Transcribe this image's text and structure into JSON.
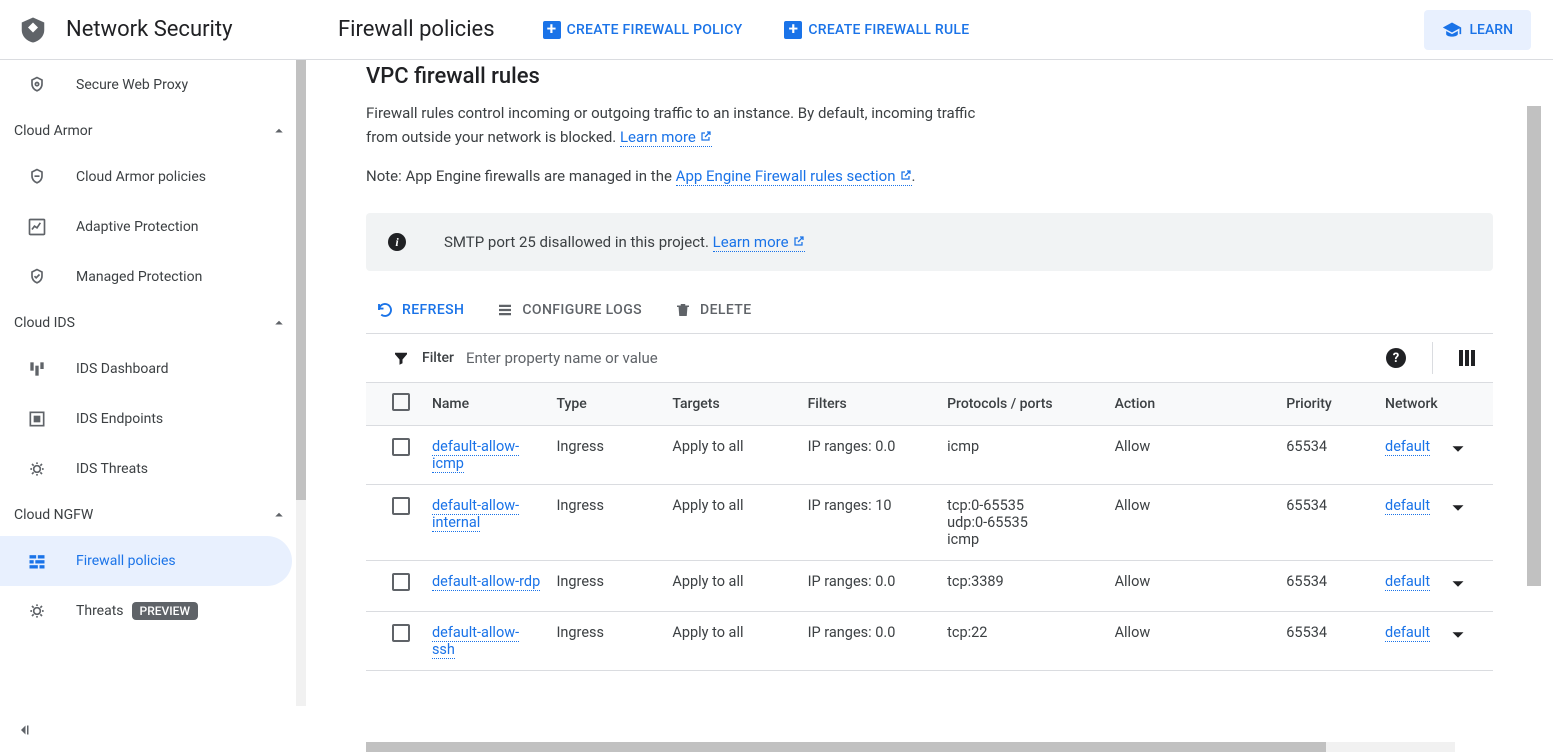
{
  "product": "Network Security",
  "header": {
    "page_title": "Firewall policies",
    "create_policy": "CREATE FIREWALL POLICY",
    "create_rule": "CREATE FIREWALL RULE",
    "learn": "LEARN"
  },
  "sidebar": {
    "item_swp": "Secure Web Proxy",
    "groups": {
      "cloud_armor": "Cloud Armor",
      "cloud_ids": "Cloud IDS",
      "cloud_ngfw": "Cloud NGFW"
    },
    "armor": {
      "policies": "Cloud Armor policies",
      "adaptive": "Adaptive Protection",
      "managed": "Managed Protection"
    },
    "ids": {
      "dashboard": "IDS Dashboard",
      "endpoints": "IDS Endpoints",
      "threats": "IDS Threats"
    },
    "ngfw": {
      "firewall_policies": "Firewall policies",
      "threats": "Threats",
      "preview_badge": "PREVIEW"
    }
  },
  "content": {
    "section_title": "VPC firewall rules",
    "desc_text": "Firewall rules control incoming or outgoing traffic to an instance. By default, incoming traffic from outside your network is blocked. ",
    "learn_more": "Learn more",
    "note_prefix": "Note: App Engine firewalls are managed in the ",
    "note_link": "App Engine Firewall rules section",
    "note_suffix": ".",
    "banner_text": "SMTP port 25 disallowed in this project. ",
    "banner_link": "Learn more"
  },
  "toolbar": {
    "refresh": "REFRESH",
    "configure_logs": "CONFIGURE LOGS",
    "delete": "DELETE"
  },
  "filter": {
    "label": "Filter",
    "placeholder": "Enter property name or value"
  },
  "table": {
    "headers": {
      "name": "Name",
      "type": "Type",
      "targets": "Targets",
      "filters": "Filters",
      "protocols": "Protocols / ports",
      "action": "Action",
      "priority": "Priority",
      "network": "Network"
    },
    "rows": [
      {
        "name": "default-allow-icmp",
        "type": "Ingress",
        "targets": "Apply to all",
        "filters": "IP ranges: 0.0",
        "protocols_a": "icmp",
        "protocols_b": "",
        "protocols_c": "",
        "action": "Allow",
        "priority": "65534",
        "network": "default"
      },
      {
        "name": "default-allow-internal",
        "type": "Ingress",
        "targets": "Apply to all",
        "filters": "IP ranges: 10",
        "protocols_a": "tcp:0-65535",
        "protocols_b": "udp:0-65535",
        "protocols_c": "icmp",
        "action": "Allow",
        "priority": "65534",
        "network": "default"
      },
      {
        "name": "default-allow-rdp",
        "type": "Ingress",
        "targets": "Apply to all",
        "filters": "IP ranges: 0.0",
        "protocols_a": "tcp:3389",
        "protocols_b": "",
        "protocols_c": "",
        "action": "Allow",
        "priority": "65534",
        "network": "default"
      },
      {
        "name": "default-allow-ssh",
        "type": "Ingress",
        "targets": "Apply to all",
        "filters": "IP ranges: 0.0",
        "protocols_a": "tcp:22",
        "protocols_b": "",
        "protocols_c": "",
        "action": "Allow",
        "priority": "65534",
        "network": "default"
      }
    ]
  }
}
